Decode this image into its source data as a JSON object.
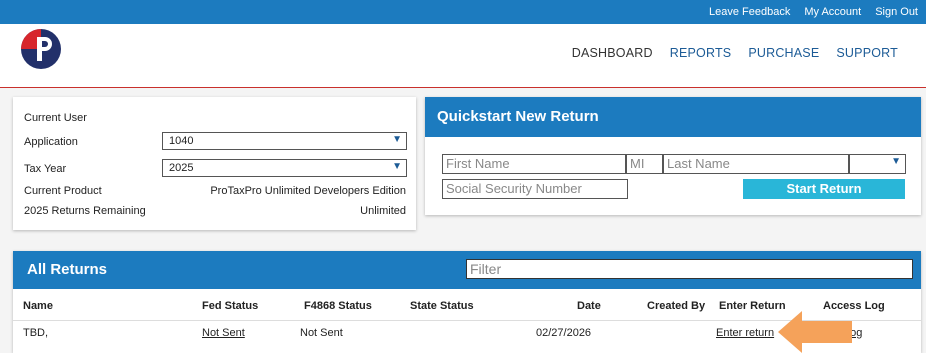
{
  "topbar": {
    "links": [
      "Leave Feedback",
      "My Account",
      "Sign Out"
    ]
  },
  "nav": {
    "items": [
      "DASHBOARD",
      "REPORTS",
      "PURCHASE",
      "SUPPORT"
    ]
  },
  "colors": {
    "brand_blue": "#1c7bbf",
    "accent_cyan": "#29b6d8",
    "logo_red": "#d7262c",
    "logo_navy": "#22306a",
    "arrow_orange": "#f5a25a"
  },
  "user_panel": {
    "current_user_label": "Current User",
    "application_label": "Application",
    "application_value": "1040",
    "tax_year_label": "Tax Year",
    "tax_year_value": "2025",
    "current_product_label": "Current Product",
    "current_product_value": "ProTaxPro Unlimited Developers Edition",
    "returns_remaining_label": "2025 Returns Remaining",
    "returns_remaining_value": "Unlimited"
  },
  "quickstart": {
    "title": "Quickstart New Return",
    "first_name_placeholder": "First Name",
    "mi_placeholder": "MI",
    "last_name_placeholder": "Last Name",
    "ssn_placeholder": "Social Security Number",
    "start_button": "Start Return"
  },
  "all_returns": {
    "title": "All Returns",
    "filter_placeholder": "Filter",
    "columns": [
      "Name",
      "Fed Status",
      "F4868 Status",
      "State Status",
      "Date",
      "Created By",
      "Enter Return",
      "Access Log"
    ],
    "rows": [
      {
        "name": "TBD,",
        "fed_status": "Not Sent",
        "f4868_status": "Not Sent",
        "state_status": "",
        "date": "02/27/2026",
        "created_by": "",
        "enter_return": "Enter return",
        "access_log": "Log"
      }
    ]
  }
}
